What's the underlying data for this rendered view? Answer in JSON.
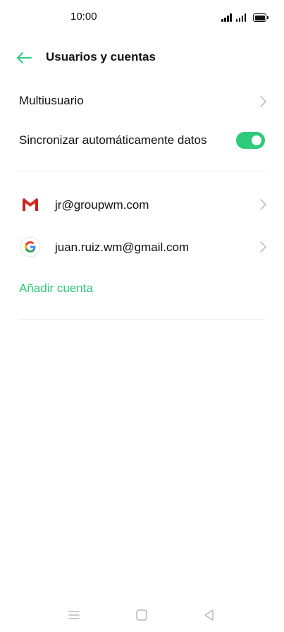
{
  "status_bar": {
    "time": "10:00"
  },
  "header": {
    "title": "Usuarios y cuentas",
    "back_icon": "arrow-left-icon"
  },
  "settings": {
    "multiuser_label": "Multiusuario",
    "auto_sync_label": "Sincronizar automáticamente datos",
    "auto_sync_enabled": true
  },
  "accounts": [
    {
      "label": "jr@groupwm.com",
      "icon": "gmail-icon"
    },
    {
      "label": "juan.ruiz.wm@gmail.com",
      "icon": "google-icon"
    }
  ],
  "add_account_label": "Añadir cuenta",
  "colors": {
    "accent": "#2dcb7a",
    "text": "#111111",
    "divider": "#e6e6e6",
    "chevron": "#b8b8b8"
  },
  "nav_bar": {
    "icons": [
      "menu-icon",
      "home-icon",
      "back-triangle-icon"
    ]
  }
}
